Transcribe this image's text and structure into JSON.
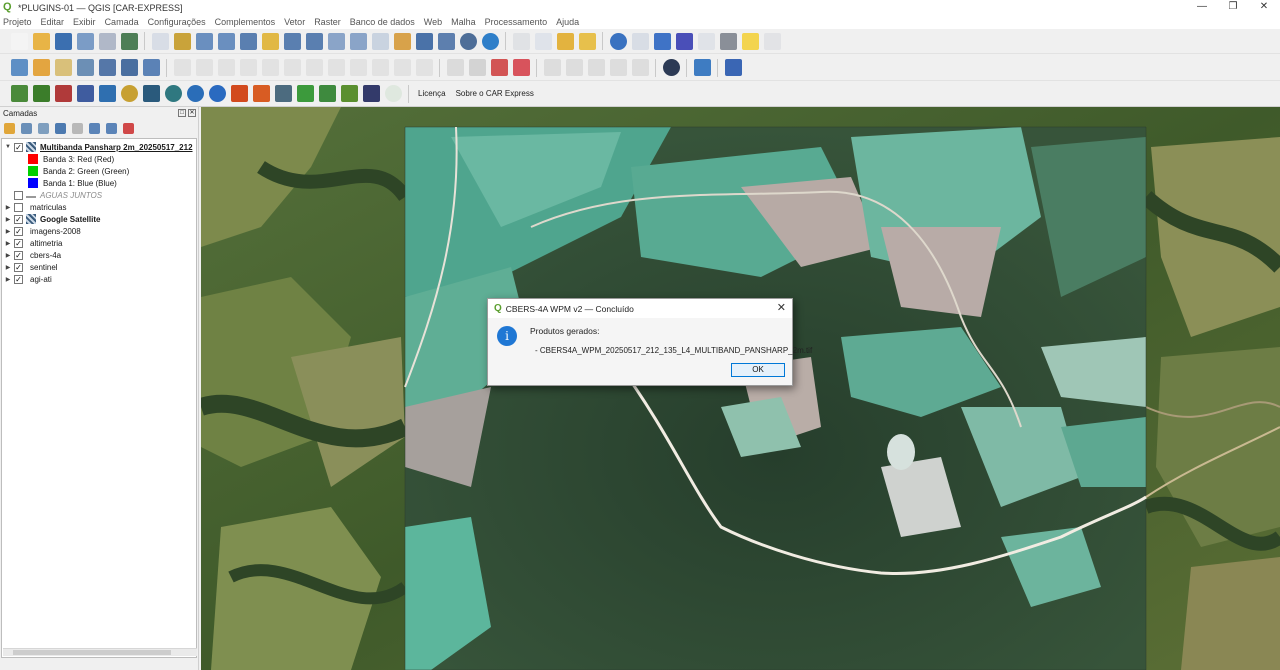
{
  "window": {
    "title": "*PLUGINS-01 — QGIS [CAR-EXPRESS]",
    "logo": "qgis-logo",
    "controls": [
      "—",
      "❐",
      "✕"
    ]
  },
  "menubar": {
    "items": [
      "Projeto",
      "Editar",
      "Exibir",
      "Camada",
      "Configurações",
      "Complementos",
      "Vetor",
      "Raster",
      "Banco de dados",
      "Web",
      "Malha",
      "Processamento",
      "Ajuda"
    ]
  },
  "toolbars": {
    "plugin_links": [
      "Licença",
      "Sobre o CAR Express"
    ]
  },
  "layers_panel": {
    "title": "Camadas",
    "rows": [
      {
        "label": "Multibanda Pansharp 2m_20250517_212",
        "checked": true,
        "expandable": true,
        "bold": true,
        "icon": "raster-icon",
        "underline": true
      },
      {
        "label": "Banda 3: Red (Red)",
        "swatch": "#ff0000"
      },
      {
        "label": "Banda 2: Green (Green)",
        "swatch": "#00d000"
      },
      {
        "label": "Banda 1: Blue (Blue)",
        "swatch": "#0000ff"
      },
      {
        "label": "AGUAS JUNTOS",
        "checked": false,
        "italic": true,
        "icon": "line-icon"
      },
      {
        "label": "matriculas",
        "checked": false,
        "expandable": true
      },
      {
        "label": "Google Satellite",
        "checked": true,
        "expandable": true,
        "bold": true,
        "icon": "raster-icon"
      },
      {
        "label": "imagens-2008",
        "checked": true,
        "expandable": true
      },
      {
        "label": "altimetria",
        "checked": true,
        "expandable": true
      },
      {
        "label": "cbers-4a",
        "checked": true,
        "expandable": true
      },
      {
        "label": "sentinel",
        "checked": true,
        "expandable": true
      },
      {
        "label": "agi-ati",
        "checked": true,
        "expandable": true
      }
    ]
  },
  "dialog": {
    "title": "CBERS-4A WPM v2 — Concluído",
    "heading": "Produtos gerados:",
    "product": "- CBERS4A_WPM_20250517_212_135_L4_MULTIBAND_PANSHARP_2m.tif",
    "ok_label": "OK",
    "icon": "info-icon"
  },
  "colors": {
    "qgis_green": "#5a9e2e",
    "accent_blue": "#0078d7",
    "info_blue": "#1f77d4"
  }
}
